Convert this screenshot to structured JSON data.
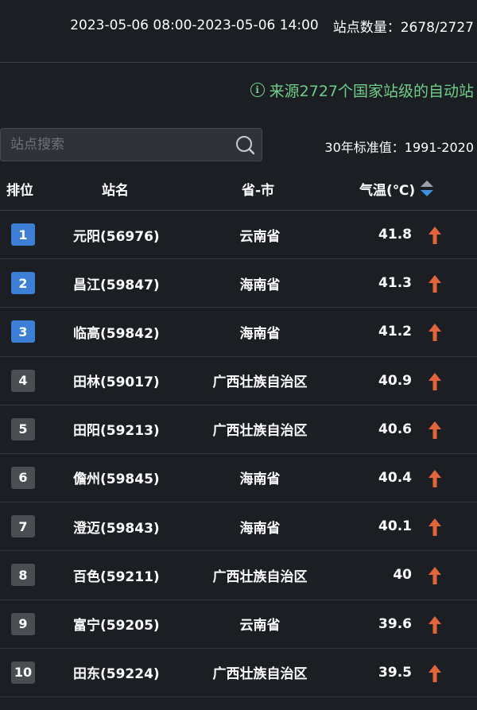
{
  "header": {
    "time_range": "2023-05-06 08:00-2023-05-06 14:00",
    "station_count_label": "站点数量：",
    "station_count_value": "2678/2727"
  },
  "source_note": "来源2727个国家站级的自动站",
  "search": {
    "placeholder": "站点搜索",
    "value": ""
  },
  "normal_period": "30年标准值：1991-2020",
  "table": {
    "columns": {
      "rank": "排位",
      "name": "站名",
      "province": "省-市",
      "temp": "气温(℃)"
    },
    "rank_colors": {
      "top3": "#3d7fd6",
      "rest": "#4a4d52"
    },
    "trend_color": "#e2643b",
    "rows": [
      {
        "rank": "1",
        "name": "元阳(56976)",
        "province": "云南省",
        "temp": "41.8",
        "trend": "up",
        "top": true
      },
      {
        "rank": "2",
        "name": "昌江(59847)",
        "province": "海南省",
        "temp": "41.3",
        "trend": "up",
        "top": true
      },
      {
        "rank": "3",
        "name": "临高(59842)",
        "province": "海南省",
        "temp": "41.2",
        "trend": "up",
        "top": true
      },
      {
        "rank": "4",
        "name": "田林(59017)",
        "province": "广西壮族自治区",
        "temp": "40.9",
        "trend": "up",
        "top": false
      },
      {
        "rank": "5",
        "name": "田阳(59213)",
        "province": "广西壮族自治区",
        "temp": "40.6",
        "trend": "up",
        "top": false
      },
      {
        "rank": "6",
        "name": "儋州(59845)",
        "province": "海南省",
        "temp": "40.4",
        "trend": "up",
        "top": false
      },
      {
        "rank": "7",
        "name": "澄迈(59843)",
        "province": "海南省",
        "temp": "40.1",
        "trend": "up",
        "top": false
      },
      {
        "rank": "8",
        "name": "百色(59211)",
        "province": "广西壮族自治区",
        "temp": "40",
        "trend": "up",
        "top": false
      },
      {
        "rank": "9",
        "name": "富宁(59205)",
        "province": "云南省",
        "temp": "39.6",
        "trend": "up",
        "top": false
      },
      {
        "rank": "10",
        "name": "田东(59224)",
        "province": "广西壮族自治区",
        "temp": "39.5",
        "trend": "up",
        "top": false
      }
    ]
  }
}
